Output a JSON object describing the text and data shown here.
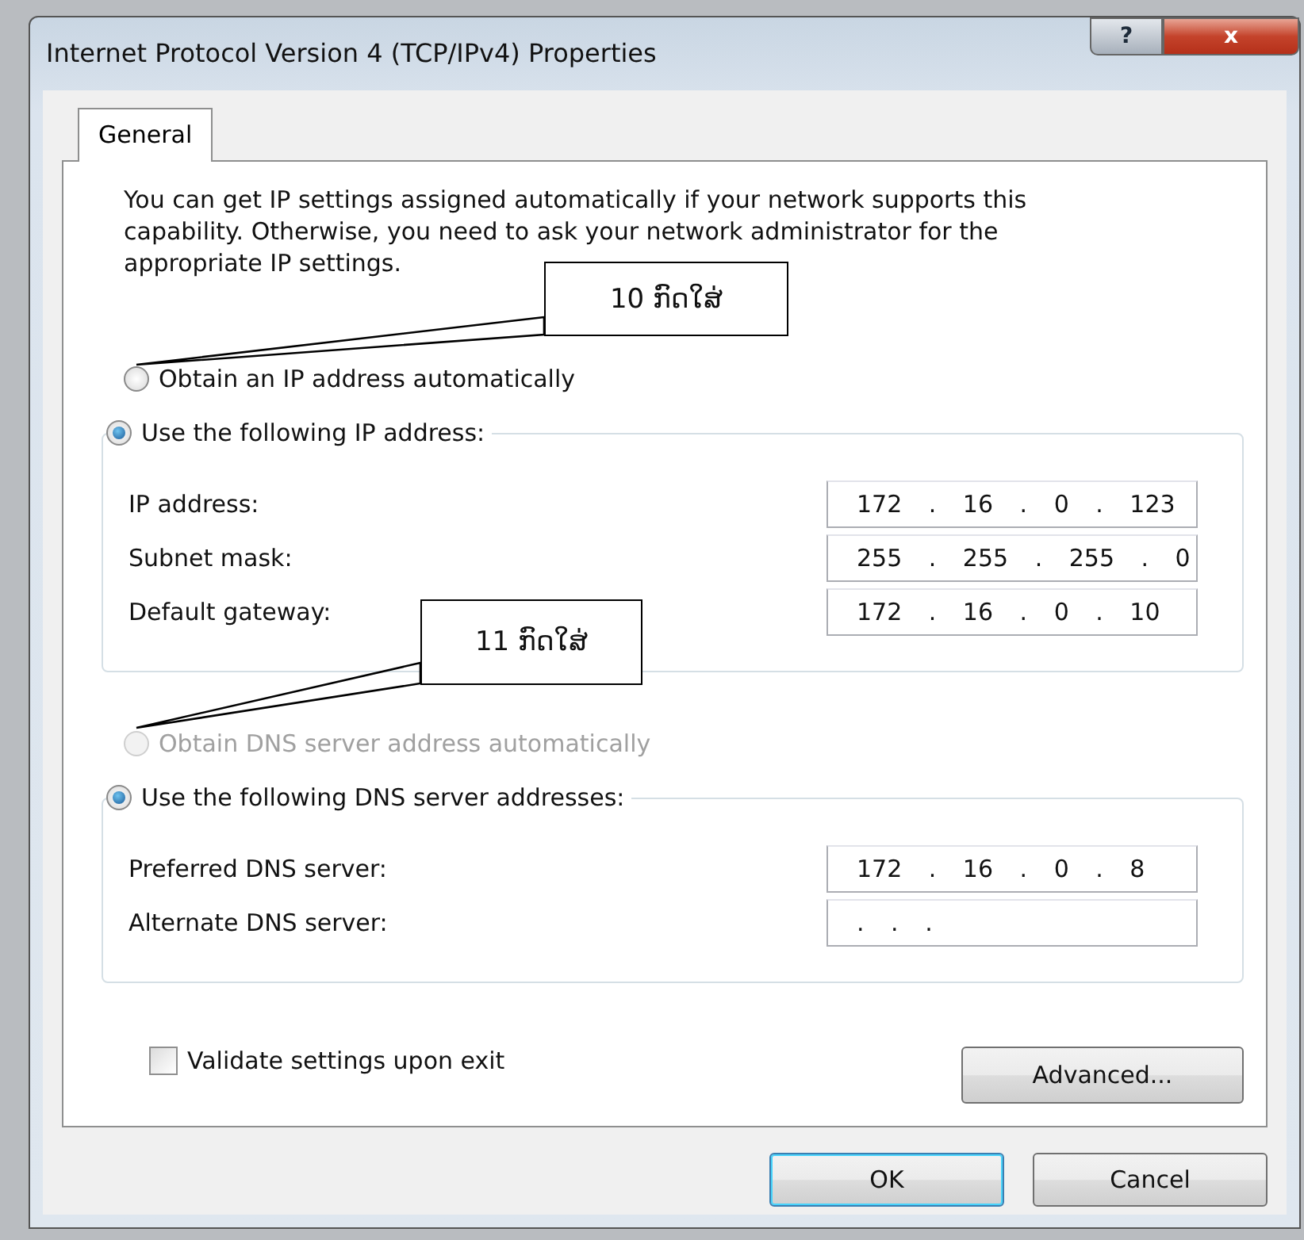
{
  "window": {
    "title": "Internet Protocol Version 4 (TCP/IPv4) Properties",
    "help_button": "?",
    "close_button": "x"
  },
  "tabs": [
    {
      "label": "General",
      "selected": true
    }
  ],
  "intro": "You can get IP settings assigned automatically if your network supports this capability. Otherwise, you need to ask your network administrator for the appropriate IP settings.",
  "ip_mode": [
    {
      "label": "Obtain an IP address automatically",
      "selected": false,
      "disabled": false
    },
    {
      "label": "Use the following IP address:",
      "selected": true,
      "disabled": false
    }
  ],
  "ip_fields": [
    {
      "label": "IP address:",
      "value": "172 . 16 . 0 . 123"
    },
    {
      "label": "Subnet mask:",
      "value": "255 . 255 . 255 . 0"
    },
    {
      "label": "Default gateway:",
      "value": "172 . 16 . 0 . 10"
    }
  ],
  "dns_mode": [
    {
      "label": "Obtain DNS server address automatically",
      "selected": false,
      "disabled": true
    },
    {
      "label": "Use the following DNS server addresses:",
      "selected": true,
      "disabled": false
    }
  ],
  "dns_fields": [
    {
      "label": "Preferred DNS server:",
      "value": "172 . 16 . 0 . 8"
    },
    {
      "label": "Alternate DNS server:",
      "value": ". . ."
    }
  ],
  "validate": {
    "label": "Validate settings upon exit",
    "checked": false
  },
  "advanced_button": "Advanced...",
  "buttons": [
    {
      "label": "OK",
      "kind": "default"
    },
    {
      "label": "Cancel",
      "kind": "normal"
    }
  ],
  "callouts": [
    {
      "text": "10 ກົດໃສ່"
    },
    {
      "text": "11 ກົດໃສ່"
    }
  ]
}
